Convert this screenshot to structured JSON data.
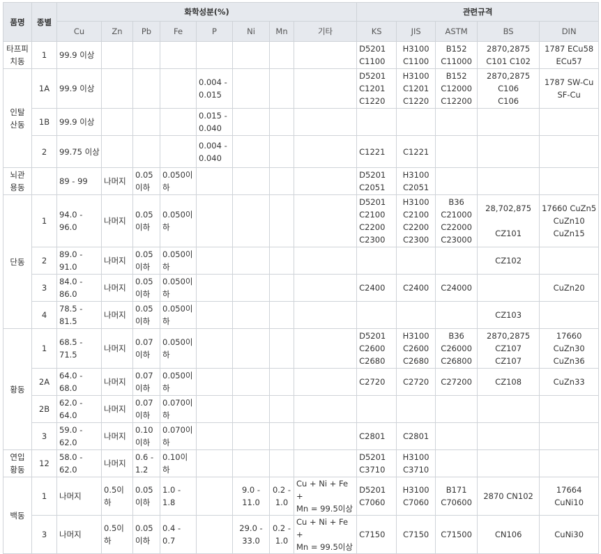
{
  "headers": {
    "product": "품명",
    "grade": "종별",
    "chem_group": "화학성분(%)",
    "std_group": "관련규격",
    "chem_cols": [
      "Cu",
      "Zn",
      "Pb",
      "Fe",
      "P",
      "Ni",
      "Mn",
      "기타"
    ],
    "std_cols": [
      "KS",
      "JIS",
      "ASTM",
      "BS",
      "DIN"
    ]
  },
  "groups": [
    {
      "name": "타프피\n치동",
      "rows": [
        {
          "grade": "1",
          "cu": "99.9  이상",
          "zn": "",
          "pb": "",
          "fe": "",
          "p": "",
          "ni": "",
          "mn": "",
          "etc": "",
          "ks": "D5201\nC1100",
          "jis": "H3100\nC1100",
          "astm": "B152\nC11000",
          "bs": "2870,2875\nC101 C102",
          "din": "1787 ECu58\nECu57"
        }
      ]
    },
    {
      "name": "인탈\n산동",
      "rows": [
        {
          "grade": "1A",
          "cu": "99.9  이상",
          "zn": "",
          "pb": "",
          "fe": "",
          "p": "0.004 -\n0.015",
          "ni": "",
          "mn": "",
          "etc": "",
          "ks": "D5201\nC1201\nC1220",
          "jis": "H3100\nC1201\nC1220",
          "astm": "B152\nC12000\nC12200",
          "bs": "2870,2875\nC106\nC106",
          "din": "1787 SW-Cu\nSF-Cu"
        },
        {
          "grade": "1B",
          "cu": "99.9  이상",
          "zn": "",
          "pb": "",
          "fe": "",
          "p": "0.015 -\n0.040",
          "ni": "",
          "mn": "",
          "etc": "",
          "ks": "",
          "jis": "",
          "astm": "",
          "bs": "",
          "din": ""
        },
        {
          "grade": "2",
          "cu": "99.75 이상",
          "zn": "",
          "pb": "",
          "fe": "",
          "p": "0.004 -\n0.040",
          "ni": "",
          "mn": "",
          "etc": "",
          "ks": "C1221",
          "jis": "C1221",
          "astm": "",
          "bs": "",
          "din": ""
        }
      ]
    },
    {
      "name": "뇌관\n용동",
      "rows": [
        {
          "grade": "",
          "cu": "89 - 99",
          "zn": "나머지",
          "pb": "0.05\n이하",
          "fe": "0.050이하",
          "p": "",
          "ni": "",
          "mn": "",
          "etc": "",
          "ks": "D5201\nC2051",
          "jis": "H3100\nC2051",
          "astm": "",
          "bs": "",
          "din": ""
        }
      ]
    },
    {
      "name": "단동",
      "rows": [
        {
          "grade": "1",
          "cu": "94.0 -\n96.0",
          "zn": "나머지",
          "pb": "0.05\n이하",
          "fe": "0.050이하",
          "p": "",
          "ni": "",
          "mn": "",
          "etc": "",
          "ks": "D5201\nC2100\nC2200\nC2300",
          "jis": "H3100\nC2100\nC2200\nC2300",
          "astm": "B36\nC21000\nC22000\nC23000",
          "bs": "28,702,875\n\nCZ101",
          "din": "17660 CuZn5\nCuZn10\nCuZn15"
        },
        {
          "grade": "2",
          "cu": "89.0 -\n91.0",
          "zn": "나머지",
          "pb": "0.05\n이하",
          "fe": "0.050이하",
          "p": "",
          "ni": "",
          "mn": "",
          "etc": "",
          "ks": "",
          "jis": "",
          "astm": "",
          "bs": "CZ102",
          "din": ""
        },
        {
          "grade": "3",
          "cu": "84.0 -\n86.0",
          "zn": "나머지",
          "pb": "0.05\n이하",
          "fe": "0.050이하",
          "p": "",
          "ni": "",
          "mn": "",
          "etc": "",
          "ks": "C2400",
          "jis": "C2400",
          "astm": "C24000",
          "bs": "",
          "din": "CuZn20"
        },
        {
          "grade": "4",
          "cu": "78.5 -\n81.5",
          "zn": "나머지",
          "pb": "0.05\n이하",
          "fe": "0.050이하",
          "p": "",
          "ni": "",
          "mn": "",
          "etc": "",
          "ks": "",
          "jis": "",
          "astm": "",
          "bs": "CZ103",
          "din": ""
        }
      ]
    },
    {
      "name": "황동",
      "rows": [
        {
          "grade": "1",
          "cu": "68.5 -\n71.5",
          "zn": "나머지",
          "pb": "0.07\n이하",
          "fe": "0.050이하",
          "p": "",
          "ni": "",
          "mn": "",
          "etc": "",
          "ks": "D5201\nC2600\nC2680",
          "jis": "H3100\nC2600\nC2680",
          "astm": "B36\nC26000\nC26800",
          "bs": "2870,2875\nCZ107\nCZ107",
          "din": "17660\nCuZn30\nCuZn36"
        },
        {
          "grade": "2A",
          "cu": "64.0 -\n68.0",
          "zn": "나머지",
          "pb": "0.07\n이하",
          "fe": "0.050이하",
          "p": "",
          "ni": "",
          "mn": "",
          "etc": "",
          "ks": "C2720",
          "jis": "C2720",
          "astm": "C27200",
          "bs": "CZ108",
          "din": "CuZn33"
        },
        {
          "grade": "2B",
          "cu": "62.0 -\n64.0",
          "zn": "나머지",
          "pb": "0.07\n이하",
          "fe": "0.070이하",
          "p": "",
          "ni": "",
          "mn": "",
          "etc": "",
          "ks": "",
          "jis": "",
          "astm": "",
          "bs": "",
          "din": ""
        },
        {
          "grade": "3",
          "cu": "59.0 -\n62.0",
          "zn": "나머지",
          "pb": "0.10\n이하",
          "fe": "0.070이하",
          "p": "",
          "ni": "",
          "mn": "",
          "etc": "",
          "ks": "C2801",
          "jis": "C2801",
          "astm": "",
          "bs": "",
          "din": ""
        }
      ]
    },
    {
      "name": "연입\n황동",
      "rows": [
        {
          "grade": "12",
          "cu": "58.0 -\n62.0",
          "zn": "나머지",
          "pb": "0.6 -\n1.2",
          "fe": "0.10이하",
          "p": "",
          "ni": "",
          "mn": "",
          "etc": "",
          "ks": "D5201\nC3710",
          "jis": "H3100\nC3710",
          "astm": "",
          "bs": "",
          "din": ""
        }
      ]
    },
    {
      "name": "백동",
      "rows": [
        {
          "grade": "1",
          "cu": "나머지",
          "zn": "0.5이\n하",
          "pb": "0.05\n이하",
          "fe": "1.0 -\n1.8",
          "p": "",
          "ni": "9.0 -\n11.0",
          "mn": "0.2 -\n1.0",
          "etc": "Cu + Ni + Fe +\nMn = 99.5이상",
          "ks": "D5201\nC7060",
          "jis": "H3100\nC7060",
          "astm": "B171\nC70600",
          "bs": "2870 CN102",
          "din": "17664 CuNi10"
        },
        {
          "grade": "3",
          "cu": "나머지",
          "zn": "0.5이\n하",
          "pb": "0.05\n이하",
          "fe": "0.4 -\n0.7",
          "p": "",
          "ni": "29.0 -\n33.0",
          "mn": "0.2 -\n1.0",
          "etc": "Cu + Ni + Fe +\nMn = 99.5이상",
          "ks": "C7150",
          "jis": "C7150",
          "astm": "C71500",
          "bs": "CN106",
          "din": "CuNi30"
        }
      ]
    }
  ]
}
